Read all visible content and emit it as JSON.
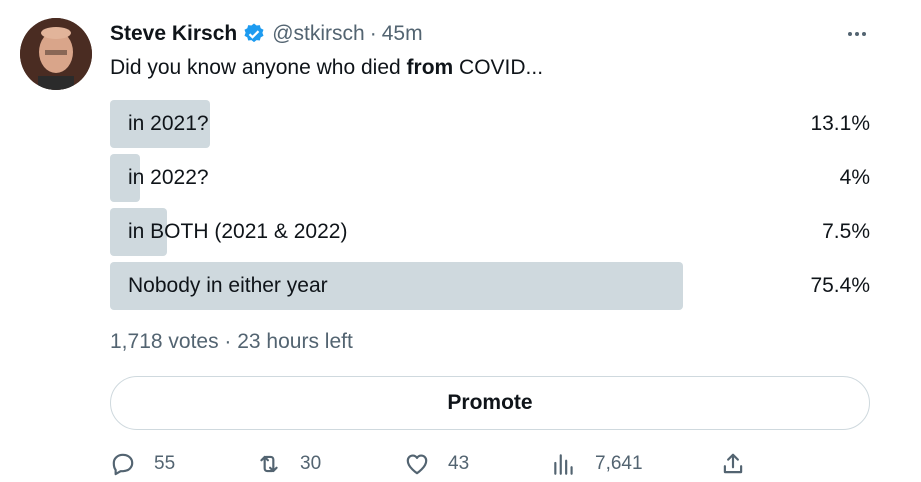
{
  "tweet": {
    "author_name": "Steve Kirsch",
    "handle": "@stkirsch",
    "separator": "·",
    "time": "45m",
    "text_before": "Did you know anyone who died ",
    "text_bold": "from",
    "text_after": " COVID..."
  },
  "poll": {
    "options": [
      {
        "label": "in 2021?",
        "percent_text": "13.1%",
        "percent": 13.1
      },
      {
        "label": "in 2022?",
        "percent_text": "4%",
        "percent": 4
      },
      {
        "label": "in BOTH (2021 & 2022)",
        "percent_text": "7.5%",
        "percent": 7.5
      },
      {
        "label": "Nobody in either year",
        "percent_text": "75.4%",
        "percent": 75.4
      }
    ],
    "meta": "1,718 votes · 23 hours left"
  },
  "promote_label": "Promote",
  "actions": {
    "replies": "55",
    "retweets": "30",
    "likes": "43",
    "views": "7,641"
  },
  "icons": {
    "verified": "verified-badge-icon",
    "more": "more-icon",
    "reply": "reply-icon",
    "retweet": "retweet-icon",
    "like": "like-icon",
    "views": "views-icon",
    "share": "share-icon"
  },
  "colors": {
    "verified": "#1d9bf0",
    "bar": "#cfd9de",
    "secondary_text": "#536471"
  }
}
